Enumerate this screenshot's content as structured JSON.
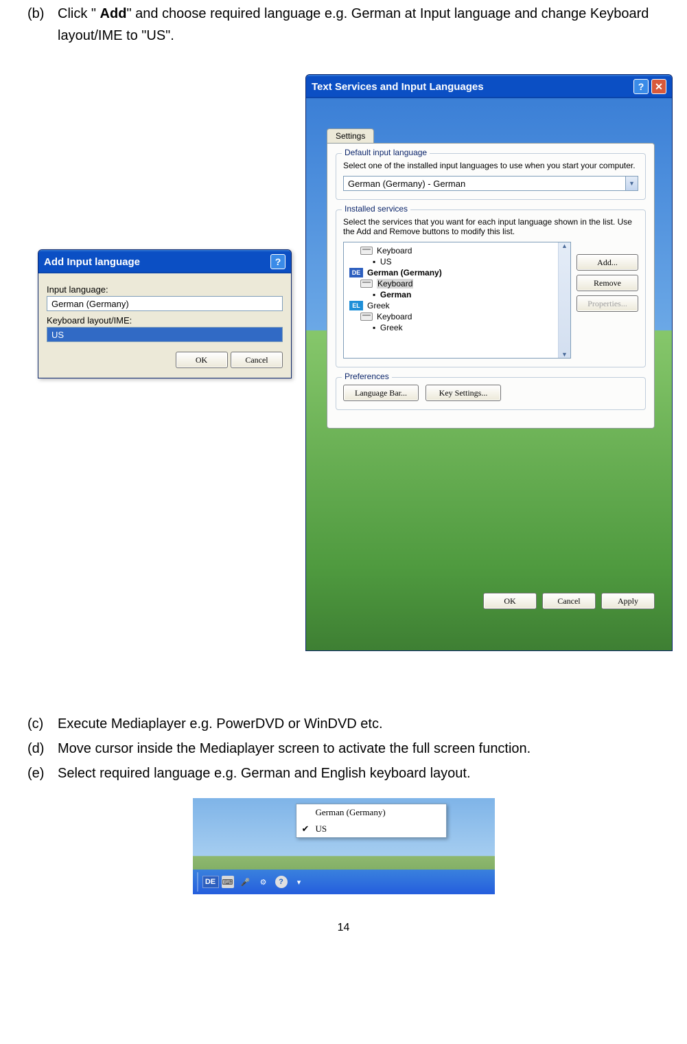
{
  "instructions": {
    "b": {
      "label": "(b)",
      "pre": "Click \" ",
      "bold": "Add",
      "post": "\" and choose required language e.g. German at Input language and change Keyboard layout/IME to \"US\"."
    },
    "c": {
      "label": "(c)",
      "text": "Execute Mediaplayer e.g. PowerDVD or WinDVD etc."
    },
    "d": {
      "label": "(d)",
      "text": "Move cursor inside the Mediaplayer screen to activate the full screen function."
    },
    "e": {
      "label": "(e)",
      "text": "Select required language e.g. German and English keyboard layout."
    }
  },
  "add_dialog": {
    "title": "Add Input language",
    "input_language_label": "Input language:",
    "input_language_value": "German (Germany)",
    "layout_label": "Keyboard layout/IME:",
    "layout_value": "US",
    "ok": "OK",
    "cancel": "Cancel",
    "help": "?",
    "close": "✕"
  },
  "text_services": {
    "title": "Text Services and Input Languages",
    "help": "?",
    "close": "✕",
    "tab": "Settings",
    "default_group": {
      "legend": "Default input language",
      "desc": "Select one of the installed input languages to use when you start your computer.",
      "value": "German (Germany) - German"
    },
    "installed_group": {
      "legend": "Installed services",
      "desc": "Select the services that you want for each input language shown in the list. Use the Add and Remove buttons to modify this list.",
      "tree": {
        "kbd": "Keyboard",
        "us": "US",
        "de_badge": "DE",
        "de": "German (Germany)",
        "de_kbd": "Keyboard",
        "de_val": "German",
        "el_badge": "EL",
        "el": "Greek",
        "el_kbd": "Keyboard",
        "el_val": "Greek"
      },
      "add": "Add...",
      "remove": "Remove",
      "properties": "Properties..."
    },
    "prefs_group": {
      "legend": "Preferences",
      "langbar": "Language Bar...",
      "keysettings": "Key Settings..."
    },
    "footer": {
      "ok": "OK",
      "cancel": "Cancel",
      "apply": "Apply"
    }
  },
  "langbar": {
    "menu": {
      "item1": "German (Germany)",
      "item2": "US",
      "check": "✔"
    },
    "indicator": "DE"
  },
  "page_number": "14"
}
